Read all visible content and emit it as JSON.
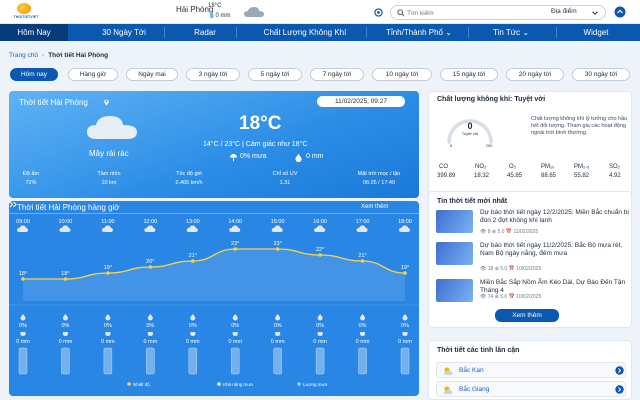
{
  "header": {
    "logo_text": "THOITIETVIET",
    "city": "Hải Phòng",
    "temp": "18°C",
    "rain": "0 mm",
    "search_placeholder": "Tìm kiếm",
    "location_select": "Địa điểm"
  },
  "nav": {
    "items": [
      "Hôm Nay",
      "30 Ngày Tới",
      "Radar",
      "Chất Lượng Không Khí",
      "Tỉnh/Thành Phố",
      "Tin Tức",
      "Widget"
    ]
  },
  "breadcrumb": {
    "home": "Trang chủ",
    "current": "Thời tiết Hải Phòng"
  },
  "tabs": [
    "Hôm nay",
    "Hàng giờ",
    "Ngày mai",
    "3 ngày tới",
    "5 ngày tới",
    "7 ngày tới",
    "10 ngày tới",
    "15 ngày tới",
    "20 ngày tới",
    "30 ngày tới"
  ],
  "hero": {
    "title": "Thời tiết Hải Phòng",
    "datetime": "11/02/2025, 09:27",
    "condition": "Mây rải rác",
    "temp": "18°C",
    "range_feel": "14°C / 23°C | Cảm giác như 18°C",
    "rain_chance": "0% mưa",
    "rain_mm": "0 mm",
    "stats": [
      {
        "label": "Độ ẩm",
        "value": "72%"
      },
      {
        "label": "Tầm nhìn",
        "value": "10 km"
      },
      {
        "label": "Tốc độ gió",
        "value": "2.465 km/h"
      },
      {
        "label": "Chỉ số UV",
        "value": "1.31"
      },
      {
        "label": "Mặt trời mọc / lặn",
        "value": "06:25 / 17:40"
      }
    ]
  },
  "hourly": {
    "title": "Thời tiết Hải Phòng hàng giờ",
    "more": "Xem thêm",
    "times": [
      "09:00",
      "10:00",
      "11:00",
      "12:00",
      "13:00",
      "14:00",
      "15:00",
      "16:00",
      "17:00",
      "18:00"
    ],
    "legend": [
      "Nhiệt độ",
      "Khả năng mưa",
      "Lượng mưa"
    ],
    "pct_labels": [
      "0%",
      "0%",
      "0%",
      "0%",
      "0%",
      "0%",
      "0%",
      "0%",
      "0%",
      "0%"
    ],
    "mm_labels": [
      "0 mm",
      "0 mm",
      "0 mm",
      "0 mm",
      "0 mm",
      "0 mm",
      "0 mm",
      "0 mm",
      "0 mm",
      "0 mm"
    ]
  },
  "chart_data": {
    "type": "line",
    "categories": [
      "09:00",
      "10:00",
      "11:00",
      "12:00",
      "13:00",
      "14:00",
      "15:00",
      "16:00",
      "17:00",
      "18:00"
    ],
    "series": [
      {
        "name": "Nhiệt độ",
        "values": [
          18,
          18,
          19,
          20,
          21,
          23,
          23,
          22,
          21,
          19
        ]
      }
    ],
    "point_labels": [
      "18°",
      "18°",
      "19°",
      "20°",
      "21°",
      "23°",
      "23°",
      "22°",
      "21°",
      "19°"
    ],
    "ylim": [
      16,
      25
    ],
    "colors": {
      "line": "#f5d24a",
      "text": "#ffffff"
    }
  },
  "air_quality": {
    "title": "Chất lượng không khí: Tuyệt vời",
    "gauge_value": "0",
    "gauge_label": "Tuyệt vời",
    "gauge_min": "0",
    "gauge_max": "200",
    "description": "Chất lượng không khí lý tưởng cho hầu hết đối tượng. Tham gia các hoạt động ngoài trời bình thường.",
    "pollutants": [
      {
        "name": "CO",
        "value": "399.89"
      },
      {
        "name": "NO₂",
        "value": "18.32"
      },
      {
        "name": "O₃",
        "value": "45.85"
      },
      {
        "name": "PM₁₀",
        "value": "88.65"
      },
      {
        "name": "PM₂.₅",
        "value": "55.82"
      },
      {
        "name": "SO₂",
        "value": "4.92"
      }
    ]
  },
  "news": {
    "title": "Tin thời tiết mới nhất",
    "items": [
      {
        "title": "Dự báo thời tiết ngày 12/2/2025: Miền Bắc chuẩn bị đón 2 đợt không khí lạnh",
        "meta": "👁 8  ⊕ 5.0  📅 11/02/2025"
      },
      {
        "title": "Dự báo thời tiết ngày 11/2/2025: Bắc Bộ mưa rét, Nam Bộ ngày nắng, đêm mưa",
        "meta": "👁 18  ⊕ 5.0  📅 10/02/2025"
      },
      {
        "title": "Miền Bắc Sắp Nồm Ẩm Kéo Dài, Dự Báo Đến Tận Tháng 4",
        "meta": "👁 74  ⊕ 5.0  📅 10/02/2025"
      }
    ],
    "more": "Xem thêm"
  },
  "nearby": {
    "title": "Thời tiết các tỉnh lân cận",
    "items": [
      "Bắc Kạn",
      "Bắc Giang"
    ]
  },
  "colors": {
    "brand": "#0a58b0",
    "nav_active": "#063c7c",
    "hero": "#2b8ce6"
  }
}
